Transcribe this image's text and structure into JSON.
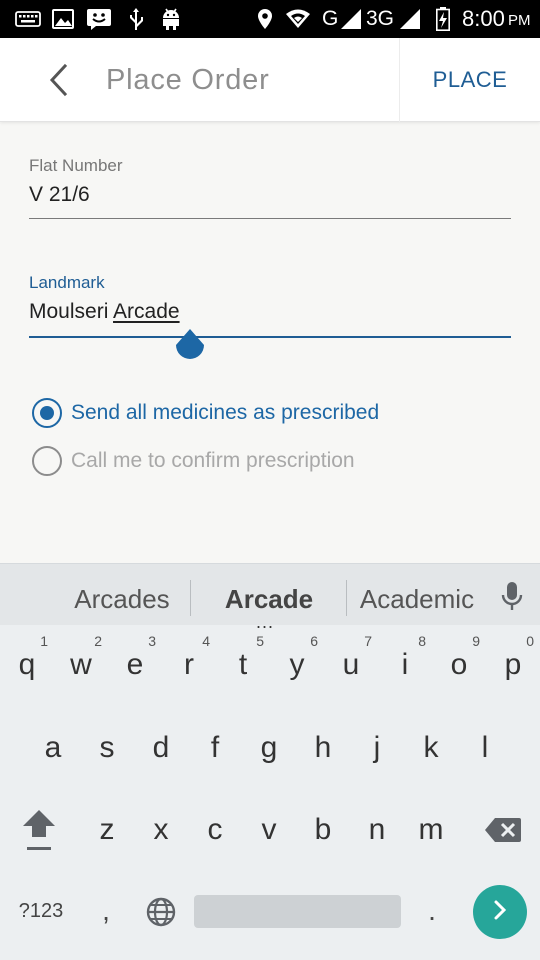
{
  "status_bar": {
    "network_label": "G",
    "network_3g_label": "3G",
    "time": "8:00",
    "ampm": "PM",
    "icons": [
      "keyboard-icon",
      "image-icon",
      "emoji-icon",
      "usb-icon",
      "android-icon",
      "location-icon",
      "wifi-icon",
      "signal-icon",
      "signal-icon",
      "battery-charging-icon"
    ]
  },
  "app_bar": {
    "title": "Place Order",
    "action_label": "PLACE",
    "back_icon": "chevron-left-icon"
  },
  "form": {
    "flat_number": {
      "label": "Flat Number",
      "value": "V 21/6"
    },
    "landmark": {
      "label": "Landmark",
      "value_plain": "Moulseri ",
      "value_underlined": "Arcade"
    },
    "radio_options": [
      {
        "label": "Send all medicines as prescribed",
        "selected": true
      },
      {
        "label": "Call me to confirm prescription",
        "selected": false
      }
    ]
  },
  "keyboard": {
    "suggestions": [
      "Arcades",
      "Arcade",
      "Academic"
    ],
    "suggestion_more": "...",
    "row1": [
      {
        "letter": "q",
        "hint": "1"
      },
      {
        "letter": "w",
        "hint": "2"
      },
      {
        "letter": "e",
        "hint": "3"
      },
      {
        "letter": "r",
        "hint": "4"
      },
      {
        "letter": "t",
        "hint": "5"
      },
      {
        "letter": "y",
        "hint": "6"
      },
      {
        "letter": "u",
        "hint": "7"
      },
      {
        "letter": "i",
        "hint": "8"
      },
      {
        "letter": "o",
        "hint": "9"
      },
      {
        "letter": "p",
        "hint": "0"
      }
    ],
    "row2": [
      "a",
      "s",
      "d",
      "f",
      "g",
      "h",
      "j",
      "k",
      "l"
    ],
    "row3": [
      "z",
      "x",
      "c",
      "v",
      "b",
      "n",
      "m"
    ],
    "symbols_label": "?123",
    "comma_label": ",",
    "period_label": "."
  },
  "colors": {
    "accent": "#1f5d94",
    "radio_selected": "#1d67a5",
    "text_disabled": "#a8a8a8",
    "enter_button": "#26a69a"
  }
}
